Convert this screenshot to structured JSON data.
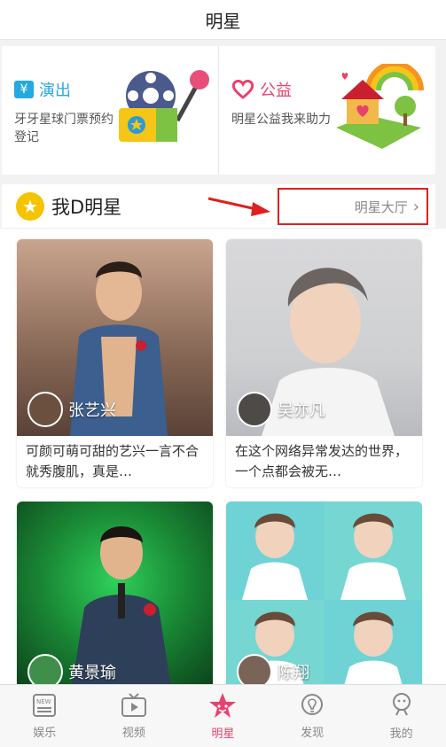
{
  "header": {
    "title": "明星"
  },
  "cards": [
    {
      "icon": "yen-icon",
      "badge": "¥",
      "title": "演出",
      "desc": "牙牙星球门票预约登记"
    },
    {
      "icon": "heart-icon",
      "title": "公益",
      "desc": "明星公益我来助力"
    }
  ],
  "section": {
    "title": "我D明星",
    "hall_label": "明星大厅"
  },
  "stars": [
    {
      "name": "张艺兴",
      "caption": "可颜可萌可甜的艺兴一言不合就秀腹肌，真是…"
    },
    {
      "name": "吴亦凡",
      "caption": "在这个网络异常发达的世界，一个点都会被无…"
    },
    {
      "name": "黄景瑜",
      "caption": ""
    },
    {
      "name": "陈翔",
      "caption": ""
    }
  ],
  "tabs": [
    {
      "label": "娱乐",
      "icon": "news-icon"
    },
    {
      "label": "视频",
      "icon": "tv-icon"
    },
    {
      "label": "明星",
      "icon": "star-icon",
      "active": true
    },
    {
      "label": "发现",
      "icon": "bulb-icon"
    },
    {
      "label": "我的",
      "icon": "profile-icon"
    }
  ],
  "colors": {
    "accent": "#e9416e",
    "blue": "#24a9e0",
    "annotation_red": "#e02020"
  }
}
